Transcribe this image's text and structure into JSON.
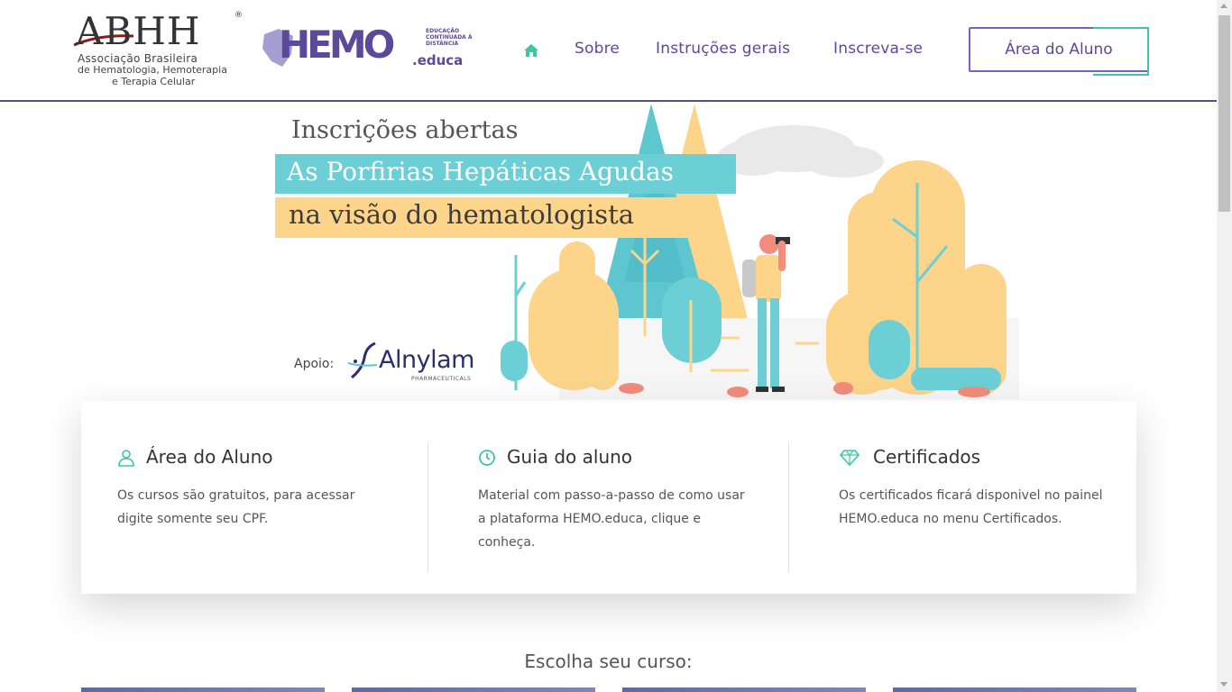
{
  "header": {
    "abhh_logo": {
      "mark": "ABHH",
      "line1": "Associação Brasileira",
      "line2": "de Hematologia, Hemoterapia",
      "line3": "e Terapia Celular"
    },
    "hemo_logo": {
      "word": "HEMO",
      "suffix": ".educa",
      "tagline": "EDUCAÇÃO CONTINUADA À DISTÂNCIA"
    },
    "nav": {
      "home_icon": "home-icon",
      "items": [
        "Sobre",
        "Instruções gerais",
        "Inscreva-se"
      ],
      "cta": "Área do Aluno"
    }
  },
  "banner": {
    "title": "Inscrições abertas",
    "line1": "As Porfirias Hepáticas Agudas",
    "line2": "na visão do hematologista",
    "apoio": "Apoio:",
    "sponsor": "Alnylam",
    "sponsor_sub": "PHARMACEUTICALS"
  },
  "features": [
    {
      "icon": "user-icon",
      "title": "Área do Aluno",
      "text": "Os cursos são gratuitos, para acessar digite somente seu CPF."
    },
    {
      "icon": "clock-icon",
      "title": "Guia do aluno",
      "text": "Material com passo-a-passo de como usar a plataforma HEMO.educa, clique e conheça."
    },
    {
      "icon": "diamond-icon",
      "title": "Certificados",
      "text": "Os certificados ficará disponivel no painel HEMO.educa no menu Certificados."
    }
  ],
  "courses": {
    "heading": "Escolha seu curso:"
  },
  "colors": {
    "brand_purple": "#5b4a9a",
    "accent_teal": "#3ec5a8",
    "banner_cyan": "#6ccfd6",
    "banner_yellow": "#fcd48a"
  }
}
